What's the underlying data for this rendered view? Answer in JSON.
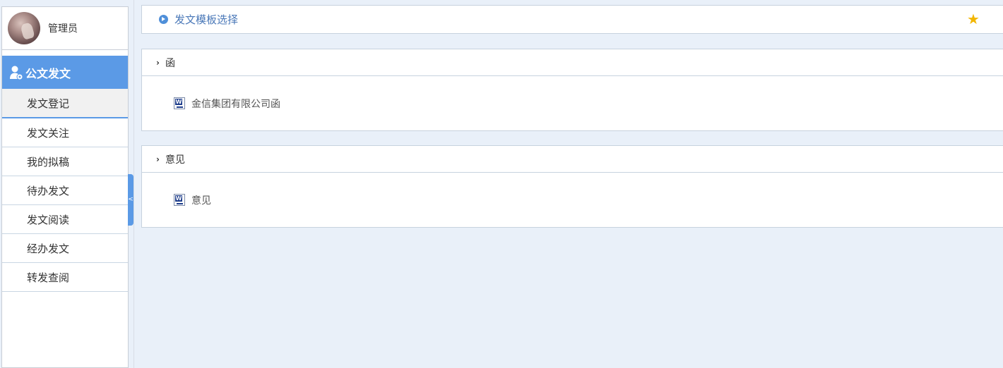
{
  "user": {
    "name": "管理员"
  },
  "module": {
    "title": "公文发文",
    "icon": "user-settings-icon"
  },
  "nav": {
    "items": [
      {
        "label": "发文登记",
        "active": true
      },
      {
        "label": "发文关注"
      },
      {
        "label": "我的拟稿"
      },
      {
        "label": "待办发文"
      },
      {
        "label": "发文阅读"
      },
      {
        "label": "经办发文"
      },
      {
        "label": "转发查阅"
      }
    ]
  },
  "collapse": {
    "glyph": "<"
  },
  "header": {
    "title": "发文模板选择",
    "star_icon": "favorite-star-icon"
  },
  "sections": [
    {
      "title": "函",
      "items": [
        {
          "label": "金信集团有限公司函",
          "icon": "word-doc-icon"
        }
      ]
    },
    {
      "title": "意见",
      "items": [
        {
          "label": "意见",
          "icon": "word-doc-icon"
        }
      ]
    }
  ],
  "colors": {
    "accent": "#5b9ae6",
    "background": "#e9f0f9",
    "star": "#f2b600",
    "title_link": "#4a78b8"
  }
}
